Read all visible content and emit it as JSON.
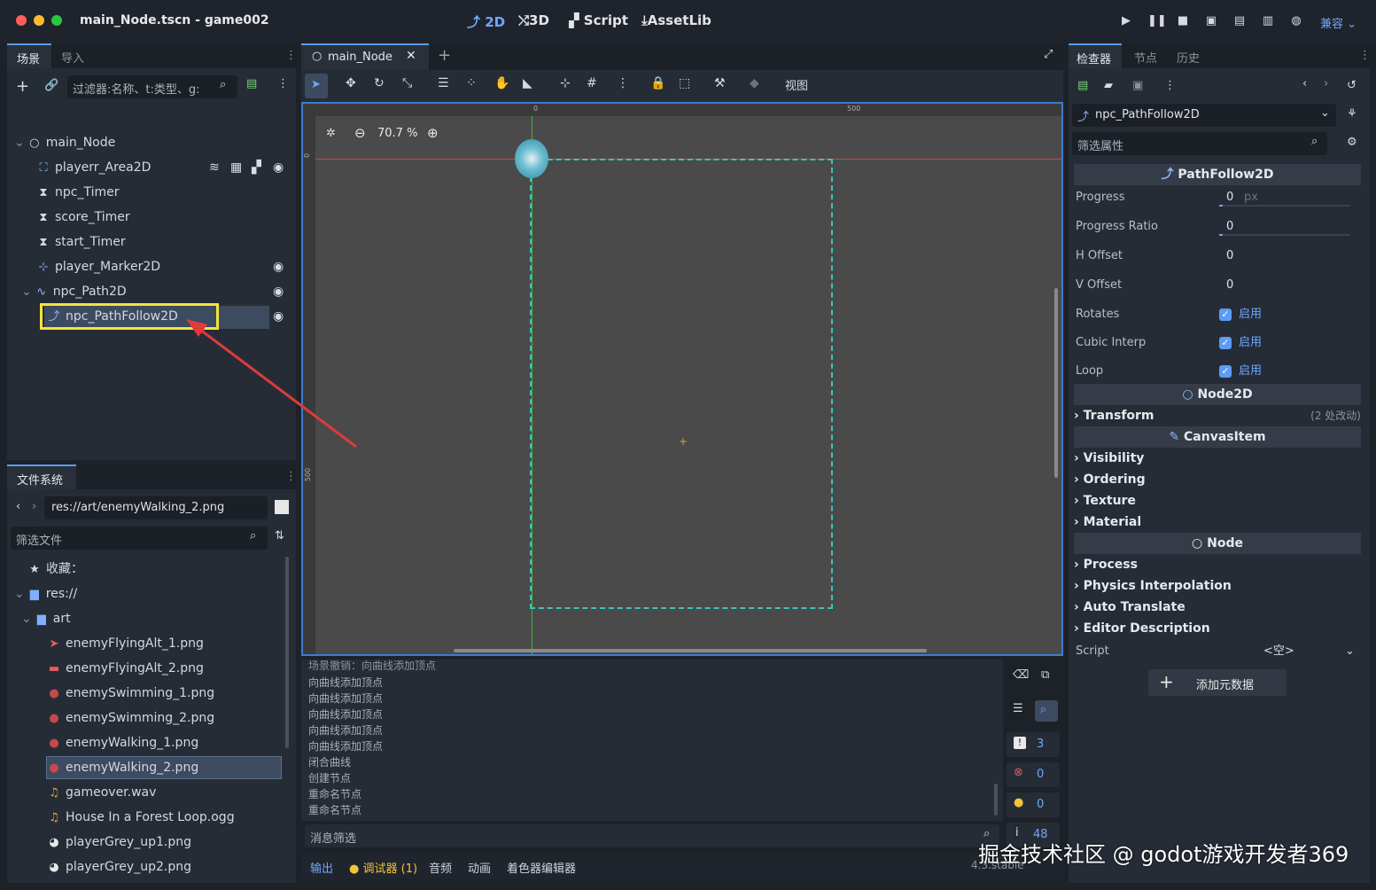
{
  "window": {
    "title": "main_Node.tscn - game002"
  },
  "modes": [
    {
      "label": "2D",
      "icon": "2d-icon"
    },
    {
      "label": "3D",
      "icon": "3d-icon"
    },
    {
      "label": "Script",
      "icon": "script-icon"
    },
    {
      "label": "AssetLib",
      "icon": "assetlib-icon"
    }
  ],
  "renderer": "兼容",
  "scene_panel": {
    "tabs": [
      "场景",
      "导入"
    ],
    "filter_placeholder": "过滤器:名称、t:类型、g:",
    "nodes": [
      {
        "name": "main_Node",
        "icon": "node-circle-icon"
      },
      {
        "name": "playerr_Area2D",
        "icon": "area2d-icon"
      },
      {
        "name": "npc_Timer",
        "icon": "timer-icon"
      },
      {
        "name": "score_Timer",
        "icon": "timer-icon"
      },
      {
        "name": "start_Timer",
        "icon": "timer-icon"
      },
      {
        "name": "player_Marker2D",
        "icon": "marker2d-icon"
      },
      {
        "name": "npc_Path2D",
        "icon": "path2d-icon"
      },
      {
        "name": "npc_PathFollow2D",
        "icon": "pathfollow2d-icon"
      }
    ]
  },
  "filesystem": {
    "tab": "文件系统",
    "path": "res://art/enemyWalking_2.png",
    "filter_placeholder": "筛选文件",
    "favorites": "收藏：",
    "root": "res://",
    "folder": "art",
    "files": [
      "enemyFlyingAlt_1.png",
      "enemyFlyingAlt_2.png",
      "enemySwimming_1.png",
      "enemySwimming_2.png",
      "enemyWalking_1.png",
      "enemyWalking_2.png",
      "gameover.wav",
      "House In a Forest Loop.ogg",
      "playerGrey_up1.png",
      "playerGrey_up2.png"
    ]
  },
  "editor": {
    "tab": "main_Node",
    "view_menu": "视图",
    "zoom": "70.7 %",
    "ruler_labels": [
      "0",
      "500"
    ],
    "vruler_labels": [
      "0",
      "500"
    ]
  },
  "output": {
    "lines": [
      "场景撤销：向曲线添加顶点",
      "向曲线添加顶点",
      "向曲线添加顶点",
      "向曲线添加顶点",
      "向曲线添加顶点",
      "向曲线添加顶点",
      "闭合曲线",
      "创建节点",
      "重命名节点",
      "重命名节点"
    ],
    "filter_placeholder": "消息筛选",
    "counts": {
      "errors": "3",
      "error_icon": "0",
      "warnings": "0",
      "info": "48"
    },
    "bottom_tabs": [
      "输出",
      "调试器 (1)",
      "音频",
      "动画",
      "着色器编辑器"
    ],
    "version": "4.3.stable"
  },
  "inspector": {
    "tabs": [
      "检查器",
      "节点",
      "历史"
    ],
    "node_name": "npc_PathFollow2D",
    "filter_placeholder": "筛选属性",
    "class_header": "PathFollow2D",
    "props": [
      {
        "key": "Progress",
        "value": "0",
        "unit": "px"
      },
      {
        "key": "Progress Ratio",
        "value": "0"
      },
      {
        "key": "H Offset",
        "value": "0"
      },
      {
        "key": "V Offset",
        "value": "0"
      }
    ],
    "checks": [
      {
        "key": "Rotates",
        "label": "启用"
      },
      {
        "key": "Cubic Interp",
        "label": "启用"
      },
      {
        "key": "Loop",
        "label": "启用"
      }
    ],
    "node2d_header": "Node2D",
    "transform": "Transform",
    "transform_note": "(2 处改动)",
    "canvasitem_header": "CanvasItem",
    "canvasitem_sections": [
      "Visibility",
      "Ordering",
      "Texture",
      "Material"
    ],
    "node_header": "Node",
    "node_sections": [
      "Process",
      "Physics Interpolation",
      "Auto Translate",
      "Editor Description"
    ],
    "script_label": "Script",
    "script_value": "<空>",
    "add_meta": "添加元数据"
  },
  "watermark": "掘金技术社区 @ godot游戏开发者369",
  "colors": {
    "accent": "#5b9cf6",
    "highlight_box": "#f3e43a",
    "arrow": "#e03a3a",
    "path": "#3fc4b1"
  }
}
